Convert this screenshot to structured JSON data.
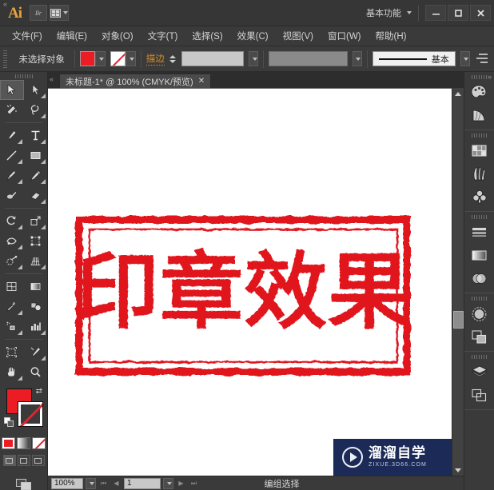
{
  "app": {
    "logo": "Ai",
    "bridge_icon": "Br",
    "arrange_icon": "arrange-documents-icon",
    "workspace": "基本功能",
    "window_controls": {
      "minimize": "–",
      "maximize": "□",
      "close": "✕"
    }
  },
  "menubar": {
    "items": [
      {
        "label": "文件(F)"
      },
      {
        "label": "编辑(E)"
      },
      {
        "label": "对象(O)"
      },
      {
        "label": "文字(T)"
      },
      {
        "label": "选择(S)"
      },
      {
        "label": "效果(C)"
      },
      {
        "label": "视图(V)"
      },
      {
        "label": "窗口(W)"
      },
      {
        "label": "帮助(H)"
      }
    ]
  },
  "controlbar": {
    "selection_status": "未选择对象",
    "fill_color": "#ec1c24",
    "stroke_color": "none",
    "stroke_label": "描边",
    "stroke_weight_value": "",
    "variable_width_value": "",
    "brush_definition": "基本",
    "panel_options_icon": "panel-options-icon"
  },
  "tools": {
    "panel_name": "工具",
    "items": [
      {
        "name": "selection-tool",
        "selected": true
      },
      {
        "name": "direct-selection-tool",
        "selected": false
      },
      {
        "name": "magic-wand-tool",
        "selected": false
      },
      {
        "name": "lasso-tool",
        "selected": false
      },
      {
        "name": "pen-tool",
        "selected": false
      },
      {
        "name": "type-tool",
        "selected": false
      },
      {
        "name": "line-segment-tool",
        "selected": false
      },
      {
        "name": "rectangle-tool",
        "selected": false
      },
      {
        "name": "paintbrush-tool",
        "selected": false
      },
      {
        "name": "pencil-tool",
        "selected": false
      },
      {
        "name": "blob-brush-tool",
        "selected": false
      },
      {
        "name": "eraser-tool",
        "selected": false
      },
      {
        "name": "rotate-tool",
        "selected": false
      },
      {
        "name": "scale-tool",
        "selected": false
      },
      {
        "name": "width-tool",
        "selected": false
      },
      {
        "name": "free-transform-tool",
        "selected": false
      },
      {
        "name": "shape-builder-tool",
        "selected": false
      },
      {
        "name": "perspective-grid-tool",
        "selected": false
      },
      {
        "name": "mesh-tool",
        "selected": false
      },
      {
        "name": "gradient-tool",
        "selected": false
      },
      {
        "name": "eyedropper-tool",
        "selected": false
      },
      {
        "name": "blend-tool",
        "selected": false
      },
      {
        "name": "symbol-sprayer-tool",
        "selected": false
      },
      {
        "name": "column-graph-tool",
        "selected": false
      },
      {
        "name": "artboard-tool",
        "selected": false
      },
      {
        "name": "slice-tool",
        "selected": false
      },
      {
        "name": "hand-tool",
        "selected": false
      },
      {
        "name": "zoom-tool",
        "selected": false
      }
    ],
    "fill_swatch": "#ec1c24",
    "stroke_swatch": "none",
    "color_modes": [
      "color-mode",
      "gradient-mode",
      "none-mode"
    ],
    "screen_modes": [
      "normal-screen-mode",
      "full-screen-with-menu",
      "full-screen-mode"
    ],
    "change_screen_mode_icon": "change-screen-mode-icon"
  },
  "document": {
    "tab_title": "未标题-1* @ 100% (CMYK/预览)",
    "tab_close": "✕"
  },
  "artwork": {
    "type": "stamp",
    "text": "印章效果",
    "color": "#e0121f",
    "border_style": "rough-double-rectangle"
  },
  "statusbar": {
    "zoom": "100%",
    "artboard_number": "1",
    "status_text": "编组选择",
    "first_label": "⏮",
    "prev_label": "◀",
    "next_label": "▶",
    "last_label": "⏭"
  },
  "dock": {
    "groups": [
      {
        "items": [
          {
            "name": "color-panel-icon"
          },
          {
            "name": "color-guide-panel-icon"
          }
        ]
      },
      {
        "items": [
          {
            "name": "swatches-panel-icon"
          },
          {
            "name": "brushes-panel-icon"
          },
          {
            "name": "symbols-panel-icon"
          }
        ]
      },
      {
        "items": [
          {
            "name": "stroke-panel-icon"
          },
          {
            "name": "gradient-panel-icon"
          },
          {
            "name": "transparency-panel-icon"
          }
        ]
      },
      {
        "items": [
          {
            "name": "appearance-panel-icon"
          },
          {
            "name": "graphic-styles-panel-icon"
          }
        ]
      },
      {
        "items": [
          {
            "name": "layers-panel-icon"
          },
          {
            "name": "artboards-panel-icon"
          }
        ]
      }
    ]
  },
  "watermark": {
    "title": "溜溜自学",
    "url": "ZIXUE.3D66.COM",
    "icon": "play-circle-icon",
    "background": "#1b2a56"
  }
}
